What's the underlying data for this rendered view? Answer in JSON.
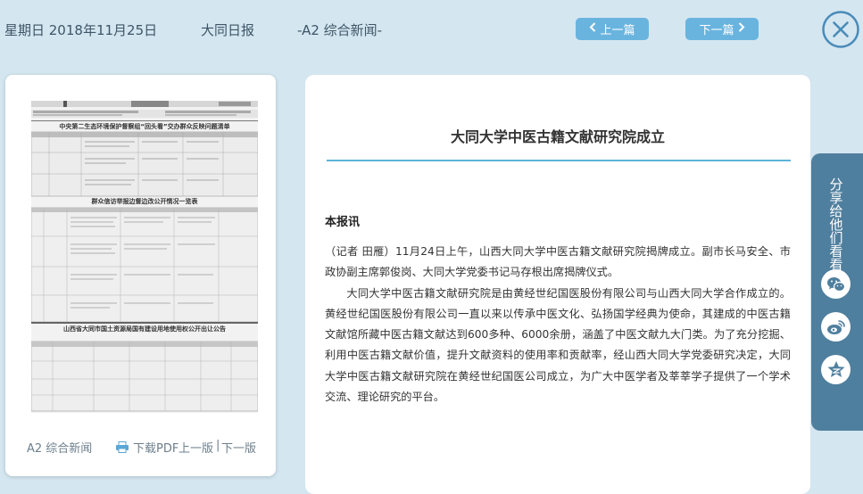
{
  "header": {
    "date": "星期日 2018年11月25日",
    "paper": "大同日报",
    "section": "-A2 综合新闻-",
    "prev_label": "上一篇",
    "next_label": "下一篇"
  },
  "page_panel": {
    "thumb_headlines": [
      "中央第二生态环境保护督察组“回头看”交办群众反映问题清单",
      "群众信访举报边督边改公开情况一览表",
      "山西省大同市国土资源局国有建设用地使用权公开出让公告"
    ],
    "section_label": "A2 综合新闻",
    "pdf_label": "下载PDF",
    "prev_page": "上一版",
    "separator": "|",
    "next_page": "下一版"
  },
  "article": {
    "title": "大同大学中医古籍文献研究院成立",
    "byline": "本报讯",
    "paragraphs": [
      "（记者 田雁）11月24日上午，山西大同大学中医古籍文献研究院揭牌成立。副市长马安全、市政协副主席郭俊岗、大同大学党委书记马存根出席揭牌仪式。",
      "大同大学中医古籍文献研究院是由黄经世纪国医股份有限公司与山西大同大学合作成立的。黄经世纪国医股份有限公司一直以来以传承中医文化、弘扬国学经典为使命，其建成的中医古籍文献馆所藏中医古籍文献达到600多种、6000余册，涵盖了中医文献九大门类。为了充分挖掘、利用中医古籍文献价值，提升文献资料的使用率和贡献率，经山西大同大学党委研究决定，大同大学中医古籍文献研究院在黄经世纪国医公司成立，为广大中医学者及莘莘学子提供了一个学术交流、理论研究的平台。"
    ]
  },
  "share": {
    "label": "分享给他们看看",
    "icons": [
      "wechat-icon",
      "weibo-icon",
      "qzone-icon"
    ]
  },
  "colors": {
    "background": "#d4e6f0",
    "accent": "#69b4df",
    "share_panel": "#4f7f9e",
    "close_icon": "#4a8bb8"
  }
}
